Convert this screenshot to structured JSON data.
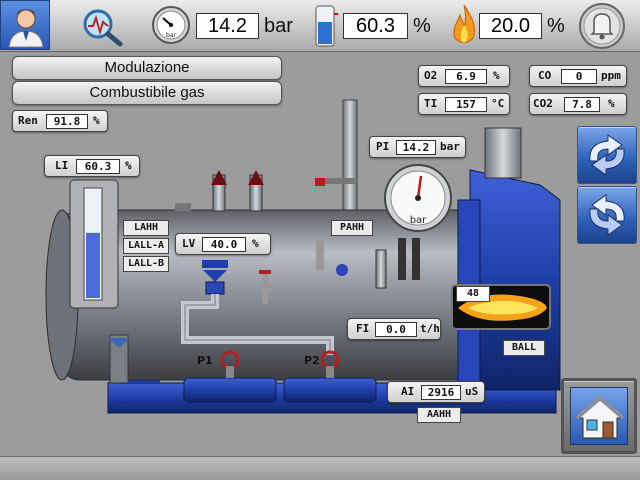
{
  "topbar": {
    "pressure": {
      "value": "14.2",
      "unit": "bar",
      "gauge_label": "bar"
    },
    "level": {
      "value": "60.3",
      "unit": "%"
    },
    "flame": {
      "value": "20.0",
      "unit": "%"
    }
  },
  "panels": {
    "modulation": "Modulazione",
    "fuel": "Combustibile gas"
  },
  "ren": {
    "label": "Ren",
    "value": "91.8",
    "unit": "%"
  },
  "combustion": {
    "o2": {
      "label": "O2",
      "value": "6.9",
      "unit": "%"
    },
    "co": {
      "label": "CO",
      "value": "0",
      "unit": "ppm"
    },
    "ti": {
      "label": "TI",
      "value": "157",
      "unit": "°C"
    },
    "co2": {
      "label": "CO2",
      "value": "7.8",
      "unit": "%"
    }
  },
  "li": {
    "label": "LI",
    "value": "60.3",
    "unit": "%",
    "fill_percent": 60.3
  },
  "level_alarms": [
    "LAHH",
    "LALL-A",
    "LALL-B"
  ],
  "lv": {
    "label": "LV",
    "value": "40.0",
    "unit": "%"
  },
  "pi": {
    "label": "PI",
    "value": "14.2",
    "unit": "bar"
  },
  "pahh": "PAHH",
  "gauge_label": "bar",
  "burner": {
    "value": "48",
    "flag": "BALL"
  },
  "fi": {
    "label": "FI",
    "value": "0.0",
    "unit": "t/h"
  },
  "pumps": {
    "p1": "P1",
    "p2": "P2"
  },
  "ai": {
    "label": "AI",
    "value": "2916",
    "unit": "uS",
    "flag": "AAHH"
  },
  "colors": {
    "accent_blue": "#1f3fa8",
    "steel": "#9a9ea6",
    "flame": "#f7a21b"
  },
  "icons": [
    "user-icon",
    "diagnostics-icon",
    "pressure-gauge-icon",
    "level-tank-icon",
    "flame-icon",
    "alarm-bell-icon",
    "rotate-forward-icon",
    "rotate-back-icon",
    "home-icon"
  ]
}
